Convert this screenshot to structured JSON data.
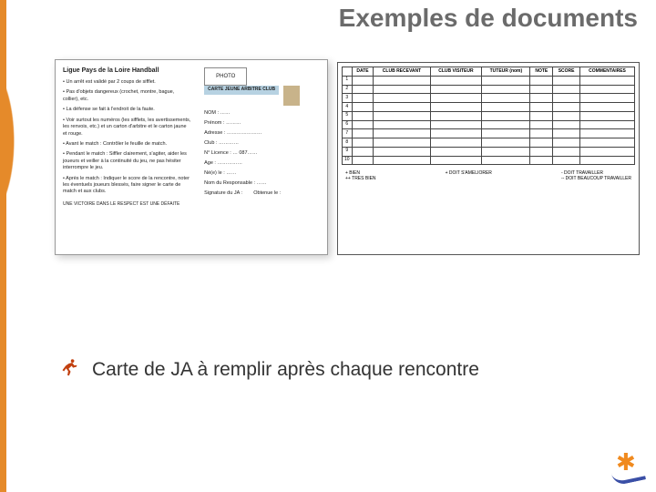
{
  "title": "Exemples de documents",
  "card": {
    "league": "Ligue Pays de la Loire Handball",
    "bullets": [
      "Un arrêt est validé par 2 coups de sifflet.",
      "Pas d'objets dangereux (crochet, montre, bague, collier), etc.",
      "La défense se fait à l'endroit de la faute.",
      "Voir surtout les numéros (les sifflets, les avertissements, les renvois, etc.) et un carton d'arbitre et le carton jaune et rouge.",
      "Avant le match : Contrôler le feuille de match.",
      "Pendant le match : Siffler clairement, s'agiter, aider les joueurs et veiller à la continuité du jeu, ne pas hésiter interrompre le jeu.",
      "Après le match : Indiquer le score de la rencontre, noter les éventuels joueurs blessés, faire signer le carte de match et aux clubs."
    ],
    "final": "UNE VICTOIRE DANS LE RESPECT EST UNE DÉFAITE",
    "header_photo": "PHOTO",
    "header_card": "CARTE JEUNE ARBITRE CLUB",
    "fields": {
      "nom": "NOM : ……",
      "prenom": "Prénom : ………",
      "adresse": "Adresse : …………………",
      "club": "Club : …………",
      "licence": "N° Licence : … 087……",
      "age": "Age : ……………",
      "naissance": "Né(e) le : ……",
      "responsable": "Nom du Responsable : ……",
      "signature": "Signature du JA :",
      "obtenue": "Obtenue le :"
    }
  },
  "table": {
    "headers": [
      "",
      "DATE",
      "CLUB RECEVANT",
      "CLUB VISITEUR",
      "TUTEUR (nom)",
      "NOTE",
      "SCORE",
      "COMMENTAIRES"
    ],
    "rows": [
      "1",
      "2",
      "3",
      "4",
      "5",
      "6",
      "7",
      "8",
      "9",
      "10"
    ],
    "legend": {
      "col1": "+ BIEN\n++ TRES BIEN",
      "col2": "+ DOIT S'AMELIORER",
      "col3": "- DOIT TRAVAILLER\n-- DOIT BEAUCOUP TRAVAILLER"
    }
  },
  "main_bullet": "Carte de JA à remplir après chaque rencontre"
}
